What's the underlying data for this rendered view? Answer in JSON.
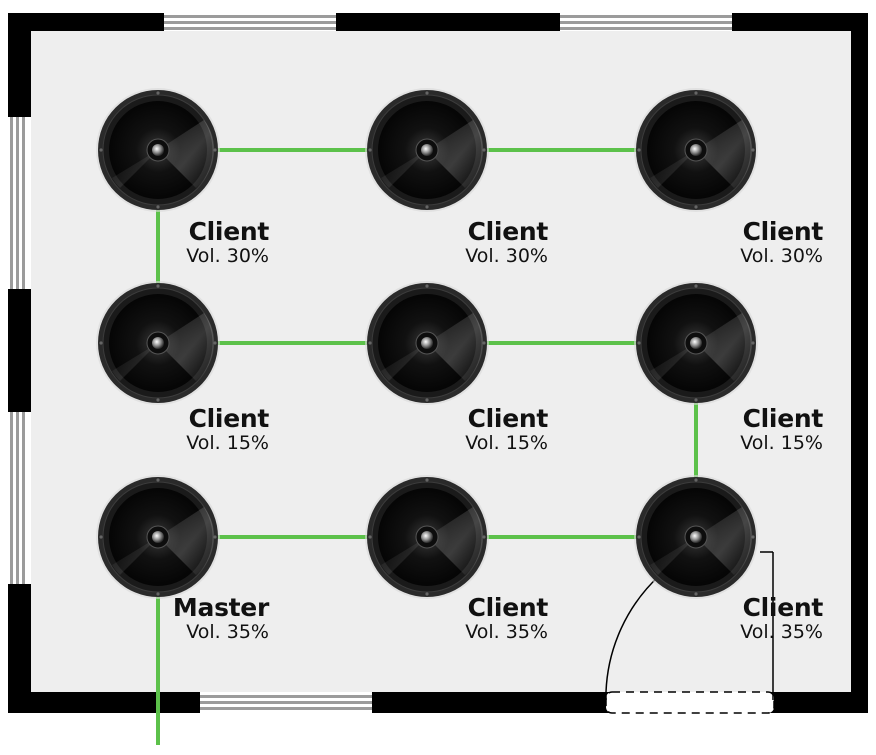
{
  "colors": {
    "room_floor": "#eeeeee",
    "wall": "#000000",
    "window_glass": "#9b9b9b",
    "cable": "#5cc14a",
    "speaker_ring": "#2a2a2a",
    "speaker_cone": "#0b0b0b"
  },
  "icon": "ceiling-speaker-icon",
  "speakers": [
    {
      "role": "Client",
      "volume": "Vol. 30%"
    },
    {
      "role": "Client",
      "volume": "Vol. 30%"
    },
    {
      "role": "Client",
      "volume": "Vol. 30%"
    },
    {
      "role": "Client",
      "volume": "Vol. 15%"
    },
    {
      "role": "Client",
      "volume": "Vol. 15%"
    },
    {
      "role": "Client",
      "volume": "Vol. 15%"
    },
    {
      "role": "Master",
      "volume": "Vol. 35%"
    },
    {
      "role": "Client",
      "volume": "Vol. 35%"
    },
    {
      "role": "Client",
      "volume": "Vol. 35%"
    }
  ],
  "links": [
    [
      0,
      1
    ],
    [
      1,
      2
    ],
    [
      0,
      3
    ],
    [
      3,
      4
    ],
    [
      4,
      5
    ],
    [
      5,
      8
    ],
    [
      6,
      7
    ],
    [
      7,
      8
    ]
  ]
}
